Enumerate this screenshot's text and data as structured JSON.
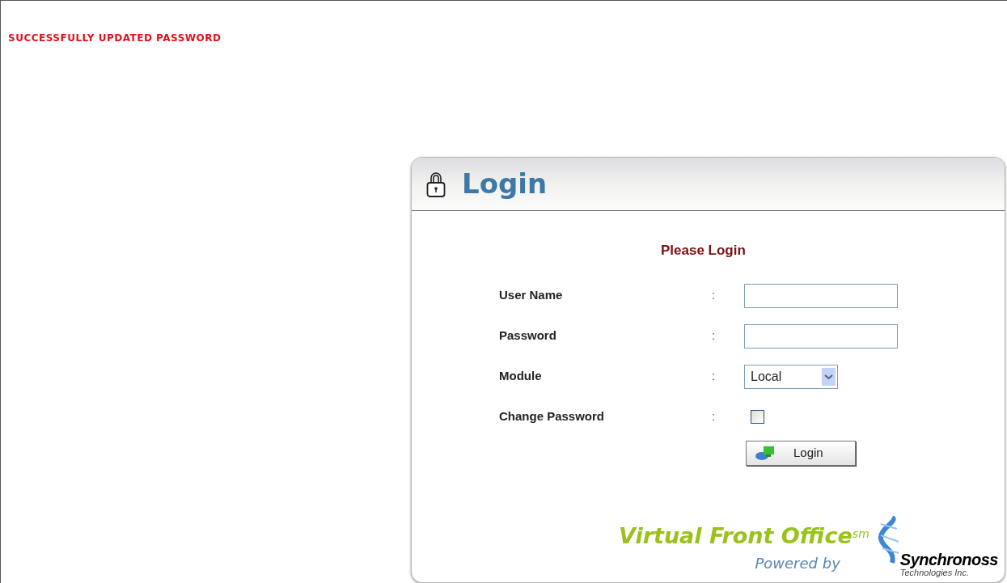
{
  "message": "SUCCESSFULLY UPDATED PASSWORD",
  "panel": {
    "title": "Login",
    "heading": "Please Login",
    "fields": [
      {
        "kind": "text",
        "label": "User Name",
        "separator": ":"
      },
      {
        "kind": "password",
        "label": "Password",
        "separator": ":"
      },
      {
        "kind": "select",
        "label": "Module",
        "separator": ":",
        "value": "Local"
      },
      {
        "kind": "checkbox",
        "label": "Change Password",
        "separator": ":",
        "checked": false
      }
    ],
    "button": "Login"
  },
  "footer": {
    "product": "Virtual Front Office$^{sm}$",
    "powered_by": "Powered by",
    "company": "Synchronoss",
    "company_sub": "Technologies Inc."
  }
}
